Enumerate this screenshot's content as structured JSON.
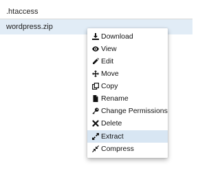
{
  "files": [
    {
      "name": ".htaccess"
    },
    {
      "name": "wordpress.zip"
    }
  ],
  "context_menu": {
    "items": [
      {
        "label": "Download",
        "icon": "download-icon"
      },
      {
        "label": "View",
        "icon": "eye-icon"
      },
      {
        "label": "Edit",
        "icon": "pencil-icon"
      },
      {
        "label": "Move",
        "icon": "move-icon"
      },
      {
        "label": "Copy",
        "icon": "copy-icon"
      },
      {
        "label": "Rename",
        "icon": "file-icon"
      },
      {
        "label": "Change Permissions",
        "icon": "key-icon"
      },
      {
        "label": "Delete",
        "icon": "close-icon"
      },
      {
        "label": "Extract",
        "icon": "expand-icon"
      },
      {
        "label": "Compress",
        "icon": "compress-icon"
      }
    ],
    "highlighted": "Extract"
  },
  "colors": {
    "selected_row": "#e1ecf6",
    "hover_item": "#d8e6f3",
    "text": "#111111"
  }
}
